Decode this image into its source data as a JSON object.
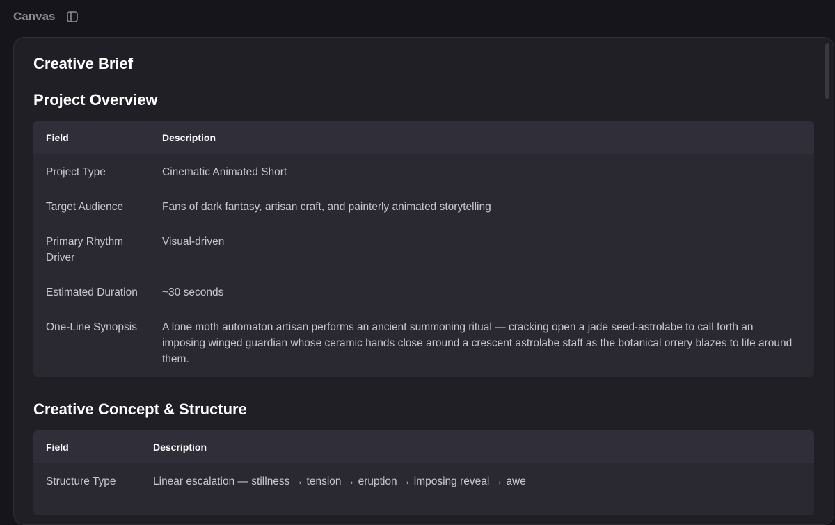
{
  "topbar": {
    "title": "Canvas",
    "panel_toggle_icon": "sidebar-panel-icon"
  },
  "document": {
    "title": "Creative Brief",
    "sections": [
      {
        "title": "Project Overview",
        "columns": [
          "Field",
          "Description"
        ],
        "rows": [
          {
            "field": "Project Type",
            "description": "Cinematic Animated Short"
          },
          {
            "field": "Target Audience",
            "description": "Fans of dark fantasy, artisan craft, and painterly animated storytelling"
          },
          {
            "field": "Primary Rhythm Driver",
            "description": "Visual-driven"
          },
          {
            "field": "Estimated Duration",
            "description": "~30 seconds"
          },
          {
            "field": "One-Line Synopsis",
            "description": "A lone moth automaton artisan performs an ancient summoning ritual — cracking open a jade seed-astrolabe to call forth an imposing winged guardian whose ceramic hands close around a crescent astrolabe staff as the botanical orrery blazes to life around them."
          }
        ]
      },
      {
        "title": "Creative Concept & Structure",
        "columns": [
          "Field",
          "Description"
        ],
        "rows": [
          {
            "field": "Structure Type",
            "description": "Linear escalation — stillness → tension → eruption → imposing reveal → awe"
          }
        ]
      }
    ]
  },
  "colors": {
    "background": "#16151b",
    "canvas": "#201f26",
    "table": "#2a2932",
    "table_header": "#302f39",
    "heading": "#ffffff",
    "body_text": "#c9c6d0",
    "muted": "#8d8a97"
  }
}
